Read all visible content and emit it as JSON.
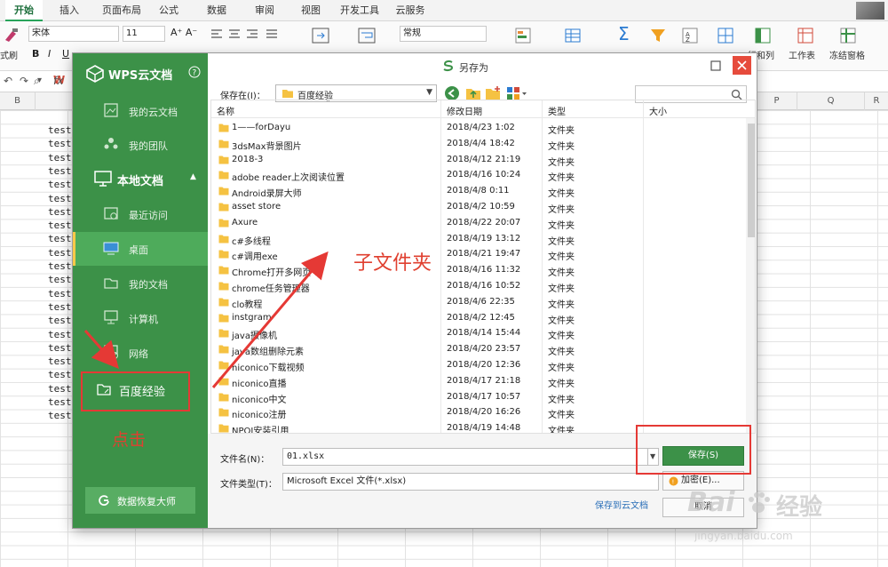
{
  "excel": {
    "tabs": [
      "开始",
      "插入",
      "页面布局",
      "公式",
      "数据",
      "审阅",
      "视图",
      "开发工具",
      "云服务"
    ],
    "font_name": "宋体",
    "font_size": "11",
    "ribbon_labels": {
      "brush": "式刷",
      "wrap": "自动换行",
      "merge": "合并居中",
      "number_format": "常规",
      "cond_format": "条件格式",
      "table_style": "表格样式",
      "sum": "求和",
      "filter": "筛选",
      "sort": "排序",
      "fill": "格式",
      "row_col": "行和列",
      "worksheet": "工作表",
      "freeze": "冻结窗格"
    },
    "fx_label": "fx",
    "columns": [
      "B",
      "P",
      "Q",
      "R"
    ],
    "cell_text": "test"
  },
  "dialog": {
    "title": "另存为",
    "sidebar": {
      "header": "WPS云文档",
      "items": [
        "我的云文档",
        "我的团队"
      ],
      "section": "本地文档",
      "local_items": [
        "最近访问",
        "桌面",
        "我的文档",
        "计算机",
        "网络",
        "百度经验"
      ],
      "restore": "数据恢复大师"
    },
    "save_in_label": "保存在(I)：",
    "save_in_value": "百度经验",
    "columns": {
      "name": "名称",
      "date": "修改日期",
      "type": "类型",
      "size": "大小"
    },
    "files": [
      {
        "name": "1——forDayu",
        "date": "2018/4/23 1:02",
        "type": "文件夹"
      },
      {
        "name": "3dsMax背景图片",
        "date": "2018/4/4 18:42",
        "type": "文件夹"
      },
      {
        "name": "2018-3",
        "date": "2018/4/12 21:19",
        "type": "文件夹"
      },
      {
        "name": "adobe reader上次阅读位置",
        "date": "2018/4/16 10:24",
        "type": "文件夹"
      },
      {
        "name": "Android录屏大师",
        "date": "2018/4/8 0:11",
        "type": "文件夹"
      },
      {
        "name": "asset store",
        "date": "2018/4/2 10:59",
        "type": "文件夹"
      },
      {
        "name": "Axure",
        "date": "2018/4/22 20:07",
        "type": "文件夹"
      },
      {
        "name": "c#多线程",
        "date": "2018/4/19 13:12",
        "type": "文件夹"
      },
      {
        "name": "c#调用exe",
        "date": "2018/4/21 19:47",
        "type": "文件夹"
      },
      {
        "name": "Chrome打开多网页",
        "date": "2018/4/16 11:32",
        "type": "文件夹"
      },
      {
        "name": "chrome任务管理器",
        "date": "2018/4/16 10:52",
        "type": "文件夹"
      },
      {
        "name": "clo教程",
        "date": "2018/4/6 22:35",
        "type": "文件夹"
      },
      {
        "name": "instgram",
        "date": "2018/4/2 12:45",
        "type": "文件夹"
      },
      {
        "name": "java摄像机",
        "date": "2018/4/14 15:44",
        "type": "文件夹"
      },
      {
        "name": "java数组删除元素",
        "date": "2018/4/20 23:57",
        "type": "文件夹"
      },
      {
        "name": "niconico下载视频",
        "date": "2018/4/20 12:36",
        "type": "文件夹"
      },
      {
        "name": "niconico直播",
        "date": "2018/4/17 21:18",
        "type": "文件夹"
      },
      {
        "name": "niconico中文",
        "date": "2018/4/17 10:57",
        "type": "文件夹"
      },
      {
        "name": "niconico注册",
        "date": "2018/4/20 16:26",
        "type": "文件夹"
      },
      {
        "name": "NPOI安装引用",
        "date": "2018/4/19 14:48",
        "type": "文件夹"
      }
    ],
    "filename_label": "文件名(N)：",
    "filename_value": "01.xlsx",
    "filetype_label": "文件类型(T)：",
    "filetype_value": "Microsoft Excel 文件(*.xlsx)",
    "save_button": "保存(S)",
    "encrypt_button": "加密(E)...",
    "cancel_button": "取消",
    "cloud_link": "保存到云文档"
  },
  "annotations": {
    "subfolder": "子文件夹",
    "click": "点击"
  },
  "watermark": {
    "brand": "Bai",
    "brand_cn": "经验",
    "url": "jingyan.baidu.com"
  },
  "colors": {
    "wps_green": "#3c9148",
    "annotation_red": "#e53935",
    "close_red": "#e64b3c"
  }
}
